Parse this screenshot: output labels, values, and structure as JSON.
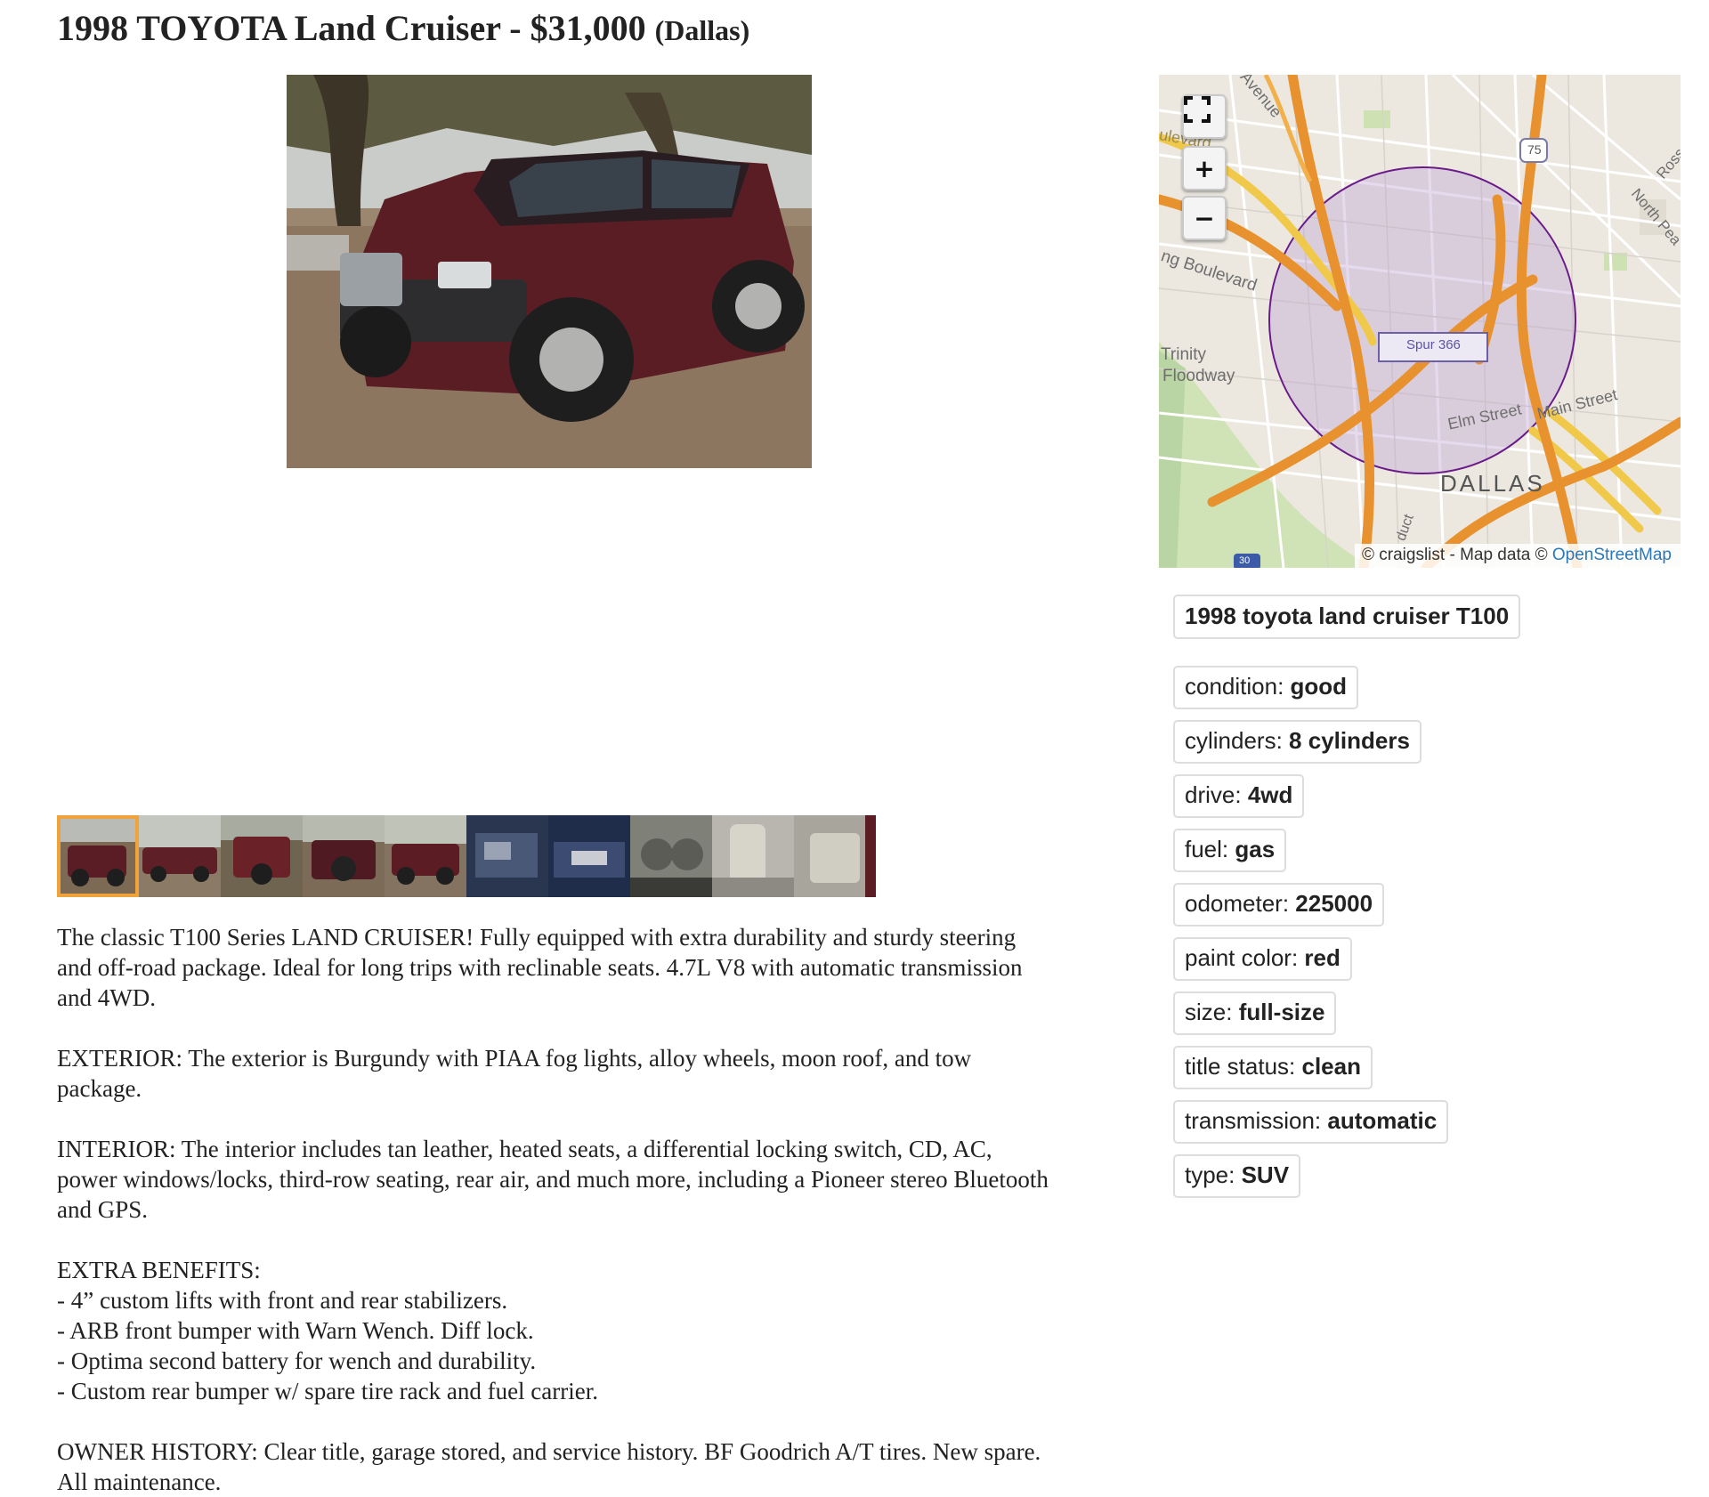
{
  "posting": {
    "title": "1998 TOYOTA Land Cruiser - $31,000",
    "location": "(Dallas)"
  },
  "gallery": {
    "thumbnail_count": 10,
    "selected_index": 0
  },
  "map": {
    "labels": {
      "avenue": "Avenue",
      "boulevard_top": "ulevard",
      "boulevard_left": "ng Boulevard",
      "trinity": "Trinity",
      "floodway": "Floodway",
      "spur": "Spur 366",
      "elm": "Elm Street",
      "main": "Main Street",
      "dallas": "DALLAS",
      "ross": "Ross",
      "north_pearl": "North Pea",
      "hwy75": "75",
      "i30": "30",
      "duct": "duct"
    },
    "attribution_prefix": "© craigslist - Map data ©",
    "attribution_link": "OpenStreetMap",
    "controls": {
      "fullscreen_icon": "fullscreen-icon",
      "zoom_in": "+",
      "zoom_out": "−"
    }
  },
  "attributes": {
    "vehicle_name": "1998 toyota land cruiser T100",
    "items": [
      {
        "label": "condition: ",
        "value": "good"
      },
      {
        "label": "cylinders: ",
        "value": "8 cylinders"
      },
      {
        "label": "drive: ",
        "value": "4wd"
      },
      {
        "label": "fuel: ",
        "value": "gas"
      },
      {
        "label": "odometer: ",
        "value": "225000"
      },
      {
        "label": "paint color: ",
        "value": "red"
      },
      {
        "label": "size: ",
        "value": "full-size"
      },
      {
        "label": "title status: ",
        "value": "clean"
      },
      {
        "label": "transmission: ",
        "value": "automatic"
      },
      {
        "label": "type: ",
        "value": "SUV"
      }
    ]
  },
  "body": {
    "p1_line1": "The classic T100 Series LAND CRUISER! Fully equipped with extra durability and sturdy steering",
    "p1_line2": "and off-road package. Ideal for long trips with reclinable seats. 4.7L V8 with automatic transmission",
    "p1_line3": "and 4WD.",
    "p2_line1": "EXTERIOR: The exterior is Burgundy with PIAA fog lights, alloy wheels, moon roof, and tow",
    "p2_line2": "package.",
    "p3_line1": "INTERIOR: The interior includes tan leather, heated seats, a differential locking switch, CD, AC,",
    "p3_line2": "power windows/locks, third-row seating, rear air, and much more, including a Pioneer stereo Bluetooth",
    "p3_line3": "and GPS.",
    "p4_heading": "EXTRA BENEFITS:",
    "p4_item1": "- 4” custom lifts with front and rear stabilizers.",
    "p4_item2": "- ARB front bumper with Warn Wench. Diff lock.",
    "p4_item3": "- Optima second battery for wench and durability.",
    "p4_item4": "- Custom rear bumper w/ spare tire rack and fuel carrier.",
    "p5_line1": "OWNER HISTORY: Clear title, garage stored, and service history. BF Goodrich A/T tires. New spare.",
    "p5_line2": "All maintenance."
  }
}
